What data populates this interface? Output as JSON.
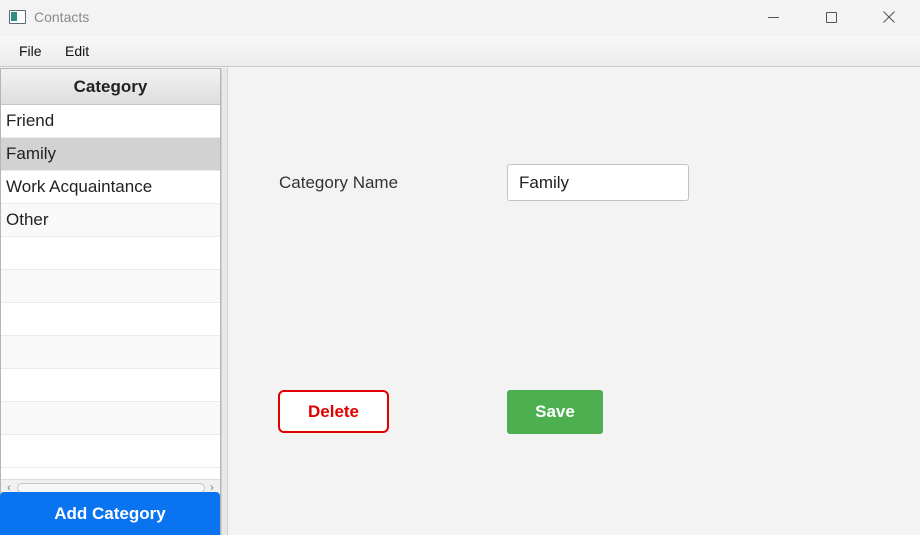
{
  "window": {
    "title": "Contacts",
    "icon": "app-window-icon"
  },
  "menu": {
    "items": [
      "File",
      "Edit"
    ]
  },
  "category_list": {
    "header": "Category",
    "items": [
      "Friend",
      "Family",
      "Work Acquaintance",
      "Other"
    ],
    "selected": "Family",
    "add_button_label": "Add Category"
  },
  "form": {
    "name_label": "Category Name",
    "name_value": "Family",
    "delete_label": "Delete",
    "save_label": "Save"
  },
  "colors": {
    "add_button": "#0a74f0",
    "delete_border": "#e00000",
    "save_button": "#4caf50",
    "selected_row": "#d2d2d2"
  }
}
